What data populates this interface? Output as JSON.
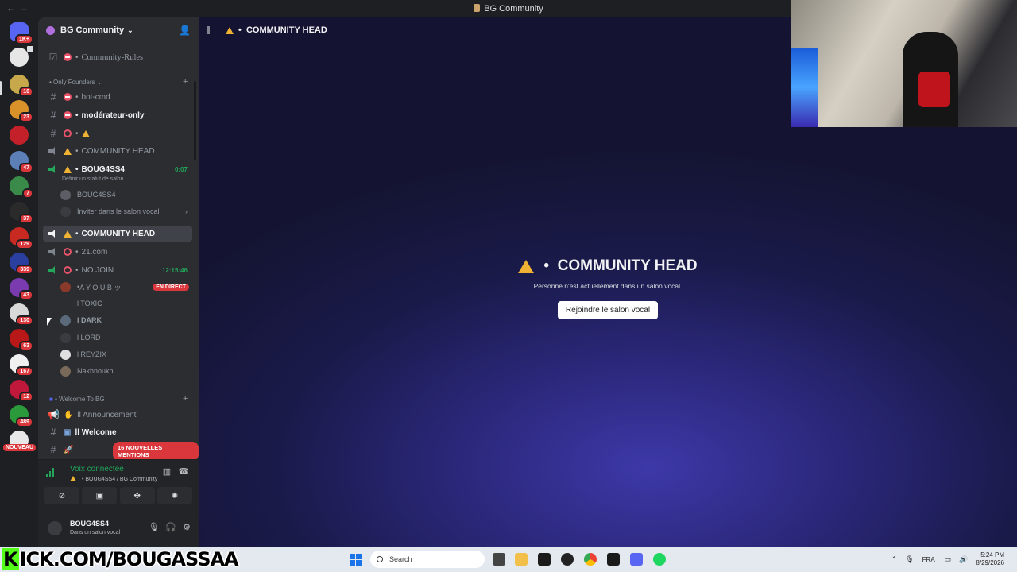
{
  "window": {
    "title": "BG Community",
    "nav_back": "←",
    "nav_fwd": "→"
  },
  "rail": {
    "badges": [
      "1K+",
      "16",
      "23",
      "47",
      "7",
      "37",
      "129",
      "339",
      "43",
      "130",
      "63",
      "167",
      "12",
      "489"
    ],
    "nouveau": "NOUVEAU"
  },
  "server": {
    "name": "BG Community"
  },
  "channels": {
    "rules": "Community-Rules",
    "cat_founders": "Only Founders",
    "bot_cmd": "bot-cmd",
    "moderateur": "modérateur-only",
    "warn_chan": "",
    "community_head_1": "COMMUNITY HEAD",
    "bougass4": "BOUG4SS4",
    "bougass4_timer": "0:07",
    "status_hint": "Définir un statut de salon",
    "member_self": "BOUG4SS4",
    "invite": "Inviter dans le salon vocal",
    "community_head_active": "COMMUNITY HEAD",
    "com21": "21.com",
    "nojoin": "NO JOIN",
    "nojoin_timer": "12:15:46",
    "m_ayoub": "A Y O U B ッ",
    "live": "EN DIRECT",
    "m_toxic": "l TOXIC",
    "m_dark": "l DARK",
    "m_lord": "l LORD",
    "m_reyzix": "l REYZIX",
    "m_nakh": "Nakhnoukh",
    "cat_welcome": "Welcome To BG",
    "announcement": "ll Announcement",
    "welcome": "ll Welcome",
    "mentions": "16 NOUVELLES MENTIONS"
  },
  "voice": {
    "title": "Voix connectée",
    "subtitle": "BOUG4SS4 / BG Community"
  },
  "user": {
    "name": "BOUG4SS4",
    "status": "Dans un salon vocal"
  },
  "main": {
    "header": "COMMUNITY HEAD",
    "title": "COMMUNITY HEAD",
    "desc": "Personne n'est actuellement dans un salon vocal.",
    "join": "Rejoindre le salon vocal"
  },
  "banner": {
    "text": "KICK.COM/BOUGASSAA",
    "k": "K"
  },
  "taskbar": {
    "search_placeholder": "Search",
    "lang": "FRA",
    "time": "5:24 PM",
    "date": "8/29/2026"
  },
  "colors": {
    "accent_green": "#23a55a",
    "mention_red": "#da373c",
    "warn_yellow": "#f0b232",
    "kick_green": "#53fc18"
  }
}
